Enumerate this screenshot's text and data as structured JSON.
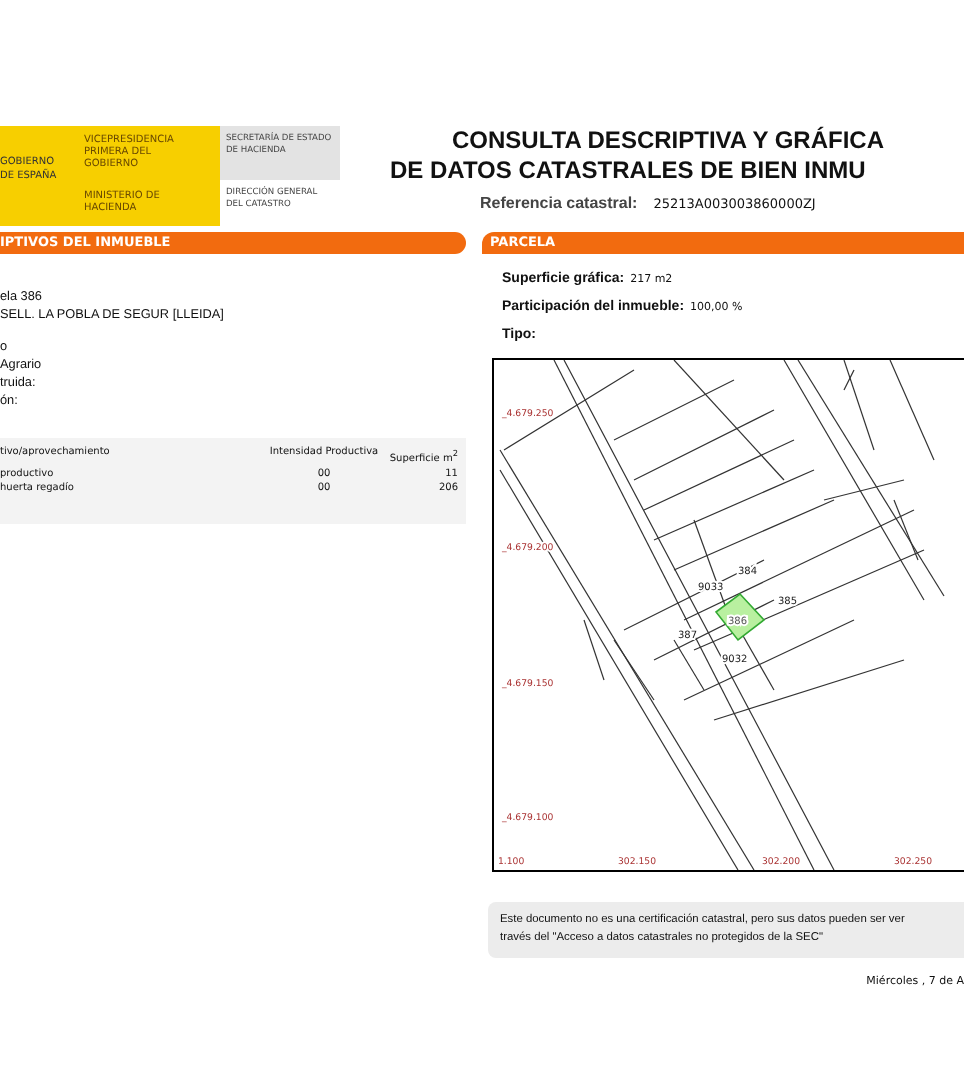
{
  "header": {
    "logo": {
      "government": [
        "GOBIERNO",
        "DE ESPAÑA"
      ],
      "vicepresidency": "VICEPRESIDENCIA PRIMERA DEL GOBIERNO",
      "ministry": "MINISTERIO DE HACIENDA",
      "secretariat": "SECRETARÍA DE ESTADO DE HACIENDA",
      "directorate": "DIRECCIÓN GENERAL DEL CATASTRO"
    },
    "title": [
      "CONSULTA DESCRIPTIVA Y GRÁFICA",
      "DE DATOS CATASTRALES DE BIEN INMU"
    ],
    "reference_label": "Referencia catastral:",
    "reference_value": "25213A003003860000ZJ"
  },
  "left_panel": {
    "title": "IPTIVOS DEL INMUEBLE",
    "address": [
      "ela 386",
      "SELL. LA POBLA DE SEGUR [LLEIDA]"
    ],
    "details": [
      "o",
      "Agrario",
      "truida:",
      "ón:"
    ],
    "table": {
      "columns": [
        "tivo/aprovechamiento",
        "Intensidad Productiva",
        "Superficie m$^{2}$"
      ],
      "rows": [
        [
          "productivo",
          "00",
          "11"
        ],
        [
          "huerta regadío",
          "00",
          "206"
        ]
      ]
    }
  },
  "right_panel": {
    "title": "PARCELA",
    "fields": [
      {
        "label": "Superficie gráfica:",
        "value": "217 m2"
      },
      {
        "label": "Participación del inmueble:",
        "value": "100,00 %"
      },
      {
        "label": "Tipo:"
      }
    ],
    "map": {
      "y_labels": [
        "_4.679.250",
        "_4.679.200",
        "_4.679.150",
        "_4.679.100"
      ],
      "x_labels": [
        "1.100",
        "302.150",
        "302.200",
        "302.250"
      ],
      "parcels": [
        {
          "label": "384",
          "selected": false
        },
        {
          "label": "385",
          "selected": false
        },
        {
          "label": "386",
          "selected": true
        },
        {
          "label": "387",
          "selected": false
        },
        {
          "label": "9033",
          "selected": false
        },
        {
          "label": "9032",
          "selected": false
        }
      ]
    }
  },
  "notice": [
    "Este documento no es una certificación catastral, pero sus datos pueden ser ver",
    "través del \"Acceso a datos catastrales no protegidos de la SEC\""
  ],
  "date": "Miércoles , 7 de A"
}
